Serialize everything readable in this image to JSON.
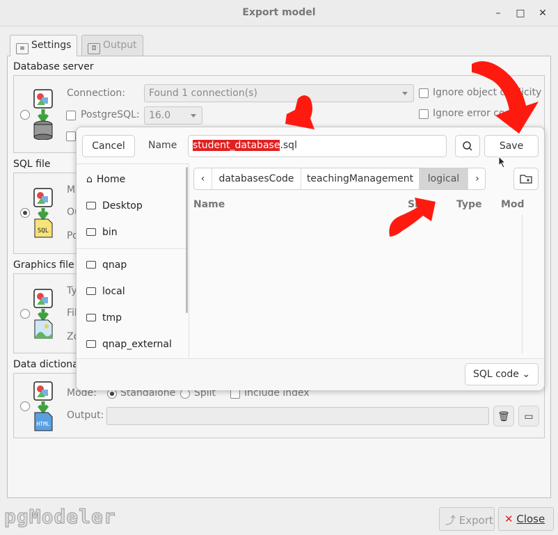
{
  "window": {
    "title": "Export model"
  },
  "tabs": [
    {
      "label": "Settings"
    },
    {
      "label": "Output"
    }
  ],
  "database_server": {
    "title": "Database server",
    "connection_label": "Connection:",
    "connection_value": "Found 1 connection(s)",
    "postgresql_label": "PostgreSQL:",
    "postgresql_version": "16.0",
    "ignore_object_label": "Ignore object duplicity",
    "ignore_error_label": "Ignore error codes"
  },
  "sql_file": {
    "title": "SQL file",
    "mode_label": "Mo",
    "output_label": "Ou",
    "postgresql_label": "Po"
  },
  "graphics_file": {
    "title": "Graphics file",
    "type_label": "Ty",
    "file_label": "Fil",
    "zoom_label": "Zo"
  },
  "data_dictionary": {
    "title": "Data dictionary",
    "mode_label": "Mode:",
    "standalone_label": "Standalone",
    "split_label": "Split",
    "include_index_label": "Include index",
    "output_label": "Output:"
  },
  "footer": {
    "logo": "pgModeler",
    "export_label": "Export",
    "close_label": "Close"
  },
  "file_dialog": {
    "cancel_label": "Cancel",
    "name_label": "Name",
    "filename_selected": "student_database",
    "filename_ext": ".sql",
    "save_label": "Save",
    "sidebar": [
      "Home",
      "Desktop",
      "bin",
      "qnap",
      "local",
      "tmp",
      "qnap_external"
    ],
    "breadcrumbs": [
      "databasesCode",
      "teachingManagement",
      "logical"
    ],
    "columns": {
      "name": "Name",
      "size": "Size",
      "type": "Type",
      "modified": "Mod"
    },
    "filter_label": "SQL code"
  },
  "colors": {
    "annotation_red": "#ff1a10",
    "selection_red": "#e02020"
  }
}
